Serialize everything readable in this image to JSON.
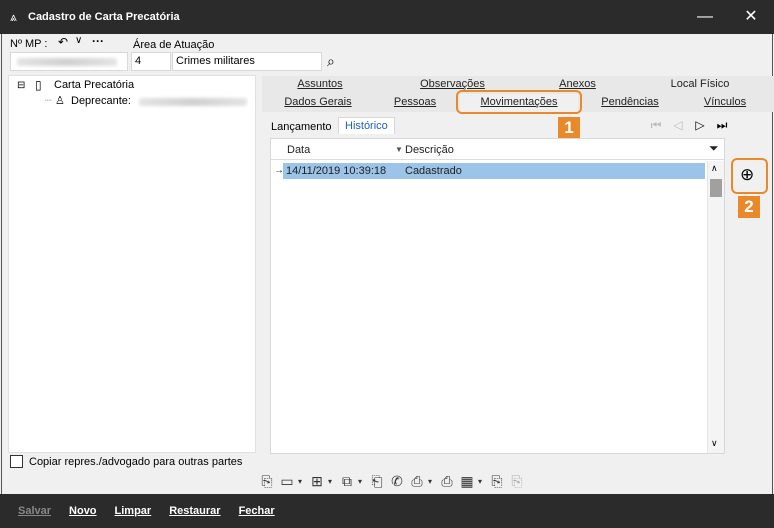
{
  "window": {
    "title": "Cadastro de Carta Precatória"
  },
  "header": {
    "mp_label": "Nº MP :",
    "area_label": "Área de Atuação",
    "area_code": "4",
    "area_name": "Crimes militares"
  },
  "tree": {
    "root": "Carta Precatória",
    "child": "Deprecante:"
  },
  "tabs_row1": [
    "Assuntos",
    "Observações",
    "Anexos",
    "Local Físico"
  ],
  "tabs_row2": [
    "Dados Gerais",
    "Pessoas",
    "Movimentações",
    "Pendências",
    "Vínculos"
  ],
  "subtabs": [
    "Lançamento",
    "Histórico"
  ],
  "grid": {
    "columns": [
      "Data",
      "Descrição"
    ],
    "rows": [
      {
        "date": "14/11/2019 10:39:18",
        "desc": "Cadastrado"
      }
    ]
  },
  "callouts": {
    "one": "1",
    "two": "2"
  },
  "copy_checkbox": "Copiar repres./advogado para outras partes",
  "footer": {
    "salvar": "Salvar",
    "novo": "Novo",
    "limpar": "Limpar",
    "restaurar": "Restaurar",
    "fechar": "Fechar"
  },
  "colors": {
    "accent": "#e88a2a",
    "selection": "#9cc3e8",
    "titlebar": "#2b2b2b"
  }
}
